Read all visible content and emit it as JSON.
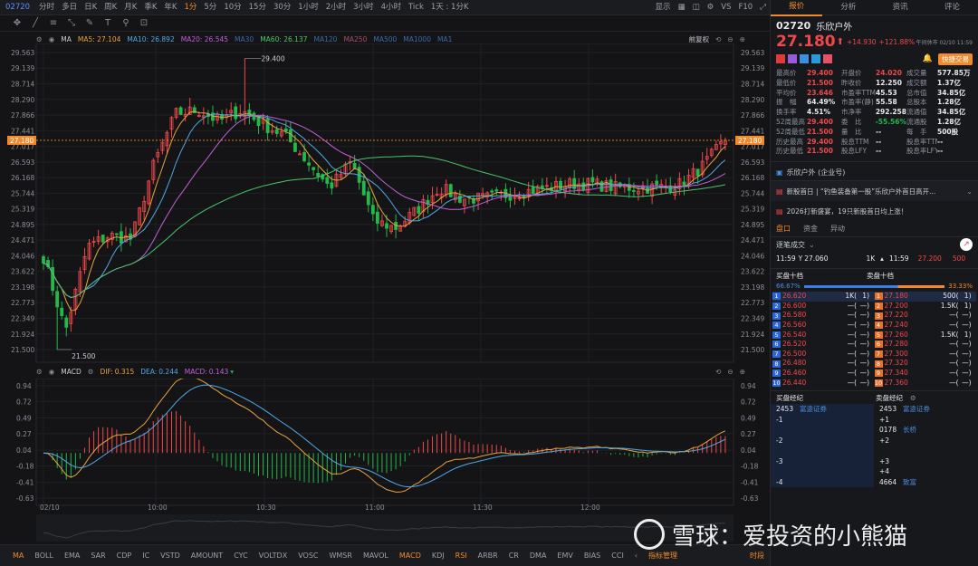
{
  "topbar": {
    "code": "02720",
    "timeframes": [
      "分时",
      "多日",
      "日K",
      "周K",
      "月K",
      "季K",
      "年K",
      "1分",
      "5分",
      "10分",
      "15分",
      "30分",
      "1小时",
      "2小时",
      "3小时",
      "4小时",
      "Tick",
      "1天 : 1分K"
    ],
    "active_timeframe": "1分",
    "right": [
      "显示",
      "VS",
      "F10"
    ]
  },
  "chart": {
    "ma_legend": [
      {
        "label": "MA5:",
        "value": "27.104",
        "color": "#e8a33c"
      },
      {
        "label": "MA10:",
        "value": "26.892",
        "color": "#4fa9e6"
      },
      {
        "label": "MA20:",
        "value": "26.545",
        "color": "#c060d8"
      },
      {
        "label": "MA30",
        "value": "",
        "color": "#3e6aa8"
      },
      {
        "label": "MA60:",
        "value": "26.137",
        "color": "#4bc56a"
      },
      {
        "label": "MA120",
        "value": "",
        "color": "#3e6aa8"
      },
      {
        "label": "MA250",
        "value": "",
        "color": "#a0506a"
      },
      {
        "label": "MA500",
        "value": "",
        "color": "#3e6aa8"
      },
      {
        "label": "MA1000",
        "value": "",
        "color": "#3e6aa8"
      },
      {
        "label": "MA1",
        "value": "",
        "color": "#3e6aa8"
      }
    ],
    "ma_prefix": "MA",
    "right_label": "前复权",
    "price_ticks": [
      "29.563",
      "29.139",
      "28.714",
      "28.290",
      "27.866",
      "27.441",
      "27.017",
      "26.593",
      "26.168",
      "25.744",
      "25.319",
      "24.895",
      "24.471",
      "24.046",
      "23.622",
      "23.198",
      "22.773",
      "22.349",
      "21.924",
      "21.500"
    ],
    "current_price_tag": "27.180",
    "high_label": "29.400",
    "low_label": "21.500",
    "macd_legend": {
      "name": "MACD",
      "dif_label": "DIF:",
      "dif": "0.315",
      "dea_label": "DEA:",
      "dea": "0.244",
      "macd_label": "MACD:",
      "macd": "0.143"
    },
    "macd_ticks": [
      "0.94",
      "0.72",
      "0.49",
      "0.27",
      "0.04",
      "-0.18",
      "-0.41",
      "-0.63"
    ],
    "time_ticks": [
      "02/10",
      "10:00",
      "10:30",
      "11:00",
      "11:30",
      "12:00"
    ]
  },
  "bottombar": {
    "indicators": [
      "MA",
      "BOLL",
      "EMA",
      "SAR",
      "CDP",
      "IC",
      "VSTD",
      "AMOUNT",
      "CYC",
      "VOLTDX",
      "VOSC",
      "WMSR",
      "MAVOL",
      "MACD",
      "KDJ",
      "RSI",
      "ARBR",
      "CR",
      "DMA",
      "EMV",
      "BIAS",
      "CCI"
    ],
    "active": [
      "MA",
      "MACD",
      "RSI"
    ],
    "manage": "指标管理",
    "timeshare": "时段"
  },
  "panel": {
    "tabs": [
      "报价",
      "分析",
      "资讯",
      "评论"
    ],
    "code": "02720",
    "name": "乐欣户外",
    "price": "27.180",
    "change": "+14.930",
    "change_pct": "+121.88%",
    "time": "午间休市 02/10 11:59",
    "quick_trade": "快捷交易",
    "stats": [
      [
        "最高价",
        "29.400",
        "red",
        "开盘价",
        "24.020",
        "red",
        "成交量",
        "577.85万",
        "white"
      ],
      [
        "最低价",
        "21.500",
        "red",
        "昨收价",
        "12.250",
        "white",
        "成交额",
        "1.37亿",
        "white"
      ],
      [
        "平均价",
        "23.646",
        "red",
        "市盈率TTM",
        "45.53",
        "white",
        "总市值",
        "34.85亿",
        "white"
      ],
      [
        "振　幅",
        "64.49%",
        "white",
        "市盈率(静)",
        "55.58",
        "white",
        "总股本",
        "1.28亿",
        "white"
      ],
      [
        "换手率",
        "4.51%",
        "white",
        "市净率",
        "292.258",
        "white",
        "流通值",
        "34.85亿",
        "white"
      ],
      [
        "52周最高",
        "29.400",
        "red",
        "委　比",
        "-55.56%",
        "green",
        "流通股",
        "1.28亿",
        "white"
      ],
      [
        "52周最低",
        "21.500",
        "red",
        "量　比",
        "--",
        "white",
        "每　手",
        "500股",
        "white"
      ],
      [
        "历史最高",
        "29.400",
        "red",
        "股息TTM",
        "--",
        "white",
        "股息率TTM",
        "--",
        "white"
      ],
      [
        "历史最低",
        "21.500",
        "red",
        "股息LFY",
        "--",
        "white",
        "股息率LFY",
        "--",
        "white"
      ]
    ],
    "company": "乐欣户外 (企业号)",
    "news": [
      "新股首日 | “钓鱼装备第一股”乐欣户外首日高开...",
      "2026打新盛宴，19只新股首日均上涨！"
    ],
    "subtabs": [
      "盘口",
      "资金",
      "异动"
    ],
    "tick_title": "逐笔成交",
    "tick": {
      "time": "11:59",
      "y_label": "Y",
      "y_price": "27.060",
      "vol1": "1K",
      "time2": "11:59",
      "price2": "27.200",
      "vol2": "500"
    },
    "book_labels": {
      "buy": "买盘十档",
      "sell": "卖盘十档",
      "buy_pct": "66.67%",
      "sell_pct": "33.33%"
    },
    "book": [
      {
        "i": "1",
        "bp": "26.620",
        "bv": "1K(",
        "bn": "1)",
        "ap": "27.180",
        "av": "500(",
        "an": "1)"
      },
      {
        "i": "2",
        "bp": "26.600",
        "bv": "—(",
        "bn": "—)",
        "ap": "27.200",
        "av": "1.5K(",
        "an": "1)"
      },
      {
        "i": "3",
        "bp": "26.580",
        "bv": "—(",
        "bn": "—)",
        "ap": "27.220",
        "av": "—(",
        "an": "—)"
      },
      {
        "i": "4",
        "bp": "26.560",
        "bv": "—(",
        "bn": "—)",
        "ap": "27.240",
        "av": "—(",
        "an": "—)"
      },
      {
        "i": "5",
        "bp": "26.540",
        "bv": "—(",
        "bn": "—)",
        "ap": "27.260",
        "av": "1.5K(",
        "an": "1)"
      },
      {
        "i": "6",
        "bp": "26.520",
        "bv": "—(",
        "bn": "—)",
        "ap": "27.280",
        "av": "—(",
        "an": "—)"
      },
      {
        "i": "7",
        "bp": "26.500",
        "bv": "—(",
        "bn": "—)",
        "ap": "27.300",
        "av": "—(",
        "an": "—)"
      },
      {
        "i": "8",
        "bp": "26.480",
        "bv": "—(",
        "bn": "—)",
        "ap": "27.320",
        "av": "—(",
        "an": "—)"
      },
      {
        "i": "9",
        "bp": "26.460",
        "bv": "—(",
        "bn": "—)",
        "ap": "27.340",
        "av": "—(",
        "an": "—)"
      },
      {
        "i": "10",
        "bp": "26.440",
        "bv": "—(",
        "bn": "—)",
        "ap": "27.360",
        "av": "—(",
        "an": "—)"
      }
    ],
    "brokers": {
      "buy_title": "买盘经纪",
      "sell_title": "卖盘经纪",
      "buy": [
        [
          "2453",
          "富途证券"
        ],
        [
          "-1",
          ""
        ],
        [
          "",
          ""
        ],
        [
          "-2",
          ""
        ],
        [
          "",
          ""
        ],
        [
          "-3",
          ""
        ],
        [
          "",
          ""
        ],
        [
          "-4",
          ""
        ]
      ],
      "sell": [
        [
          "2453",
          "富途证券"
        ],
        [
          "+1",
          ""
        ],
        [
          "0178",
          "长桥"
        ],
        [
          "+2",
          ""
        ],
        [
          "",
          ""
        ],
        [
          "+3",
          ""
        ],
        [
          "+4",
          ""
        ],
        [
          "4664",
          "致富"
        ]
      ]
    }
  },
  "watermark": "雪球：爱投资的小熊猫",
  "colors": {
    "up": "#f0484a",
    "down": "#23b84a",
    "accent": "#f08a2c"
  }
}
